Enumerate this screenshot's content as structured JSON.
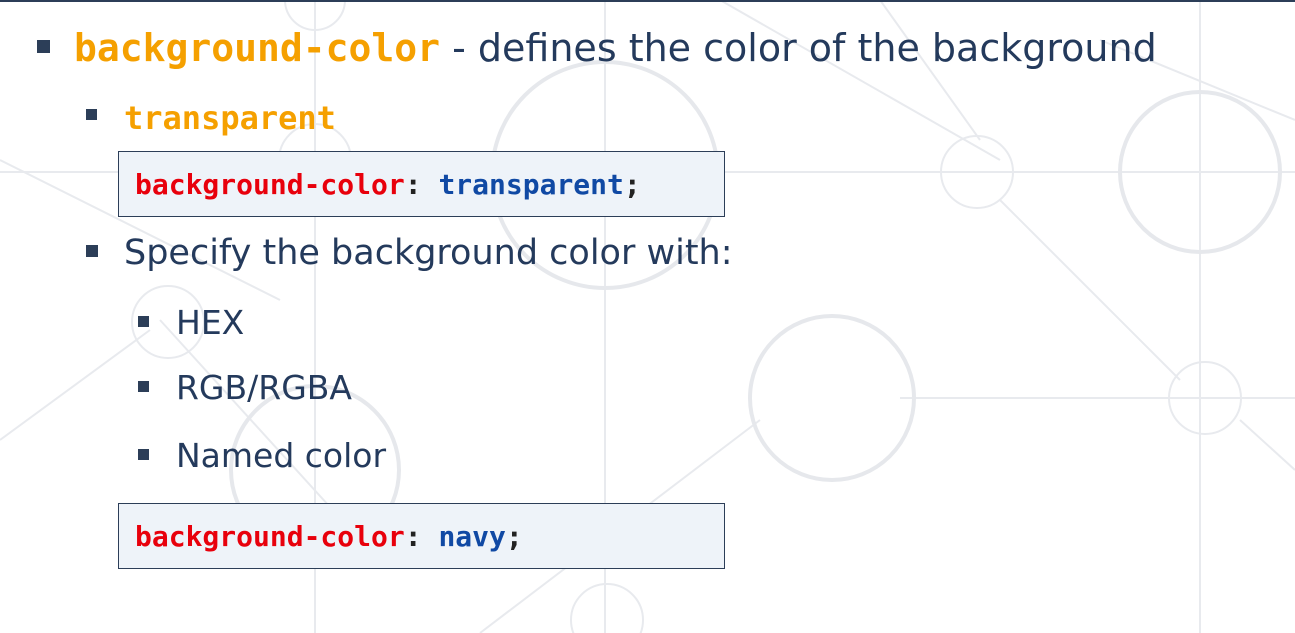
{
  "main_bullet": {
    "keyword": "background-color",
    "description": " - defines the color of the background"
  },
  "sub_bullets": {
    "transparent_label": "transparent",
    "specify_label": "Specify the background color with:",
    "options": [
      "HEX",
      "RGB/RGBA",
      "Named color"
    ]
  },
  "code_examples": [
    {
      "property": "background-color",
      "colon": ": ",
      "value": "transparent",
      "semicolon": ";"
    },
    {
      "property": "background-color",
      "colon": ": ",
      "value": "navy",
      "semicolon": ";"
    }
  ],
  "colors": {
    "text": "#243a5c",
    "keyword": "#f5a000",
    "code_property": "#e8000c",
    "code_value": "#1049a4",
    "code_box_bg": "#eef3f9",
    "bullet": "#2c3e58",
    "background_lines": "#e6e8ec"
  }
}
